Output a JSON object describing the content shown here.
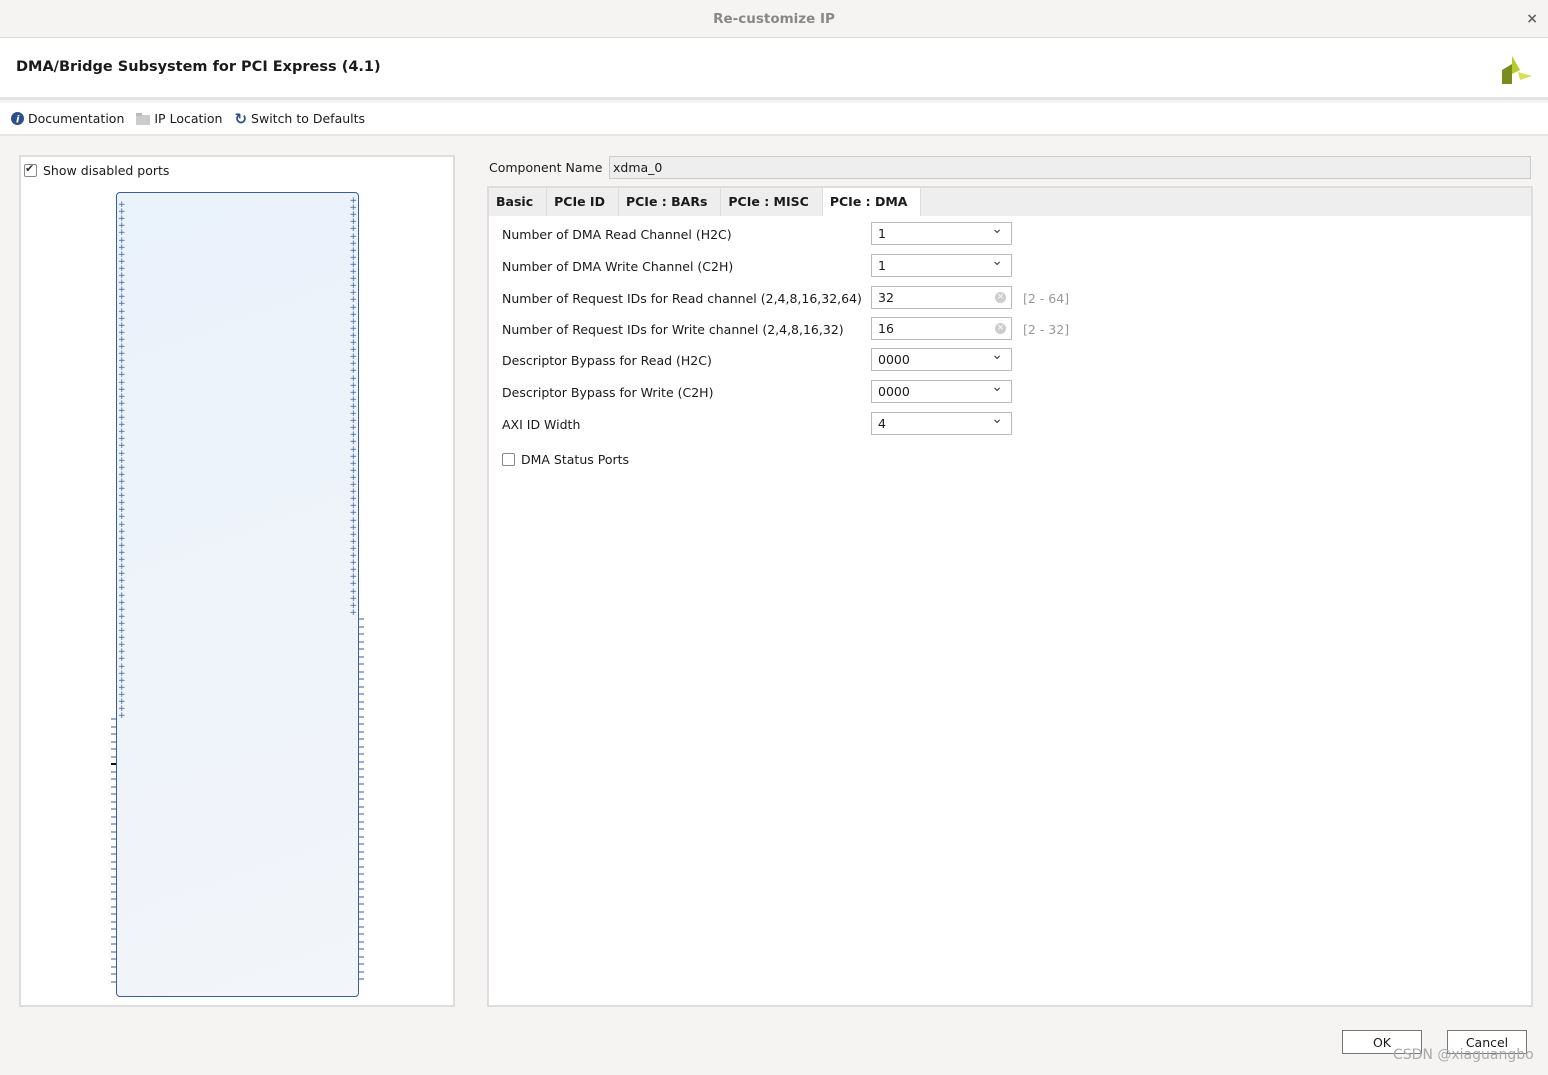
{
  "window": {
    "title": "Re-customize IP",
    "close": "×"
  },
  "header": {
    "title": "DMA/Bridge Subsystem for PCI Express (4.1)"
  },
  "toolbar": {
    "documentation": "Documentation",
    "ip_location": "IP Location",
    "switch_defaults": "Switch to Defaults"
  },
  "left": {
    "show_disabled_ports": "Show disabled ports",
    "show_disabled_checked": true
  },
  "component": {
    "label": "Component Name",
    "value": "xdma_0"
  },
  "tabs": [
    "Basic",
    "PCIe ID",
    "PCIe : BARs",
    "PCIe : MISC",
    "PCIe : DMA"
  ],
  "active_tab": "PCIe : DMA",
  "fields": [
    {
      "label": "Number of DMA Read Channel (H2C)",
      "value": "1",
      "type": "dropdown"
    },
    {
      "label": "Number of DMA Write Channel (C2H)",
      "value": "1",
      "type": "dropdown"
    },
    {
      "label": "Number of Request IDs for Read channel (2,4,8,16,32,64)",
      "value": "32",
      "type": "text",
      "range": "[2 - 64]"
    },
    {
      "label": "Number of Request IDs for Write channel (2,4,8,16,32)",
      "value": "16",
      "type": "text",
      "range": "[2 - 32]"
    },
    {
      "label": "Descriptor Bypass for Read (H2C)",
      "value": "0000",
      "type": "dropdown"
    },
    {
      "label": "Descriptor Bypass for Write (C2H)",
      "value": "0000",
      "type": "dropdown"
    },
    {
      "label": "AXI ID Width",
      "value": "4",
      "type": "dropdown"
    }
  ],
  "dma_status_ports": {
    "label": "DMA Status Ports",
    "checked": false
  },
  "buttons": {
    "ok": "OK",
    "cancel": "Cancel"
  },
  "watermark": "CSDN @xiaguangbo"
}
